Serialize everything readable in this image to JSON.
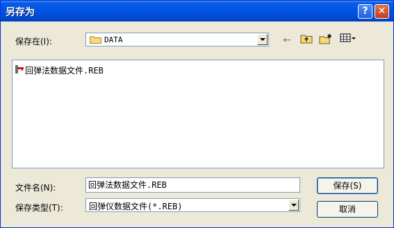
{
  "window": {
    "title": "另存为",
    "help_glyph": "?",
    "close_glyph": "✕"
  },
  "save_in": {
    "label": "保存在(I):",
    "value": "DATA"
  },
  "toolbar": {
    "back_glyph": "←",
    "up_glyph": "⇧",
    "new_folder_glyph": "✱",
    "view_glyph": "▦▾"
  },
  "files": [
    {
      "name": "回弹法数据文件.REB",
      "icon": "reb-file-icon"
    }
  ],
  "file_name": {
    "label": "文件名(N):",
    "value": "回弹法数据文件.REB"
  },
  "file_type": {
    "label": "保存类型(T):",
    "value": "回弹仪数据文件(*.REB)"
  },
  "buttons": {
    "save": "保存(S)",
    "cancel": "取消"
  },
  "colors": {
    "titlebar": "#0054e3",
    "dialog_bg": "#ece9d8",
    "border": "#7f9db9"
  }
}
